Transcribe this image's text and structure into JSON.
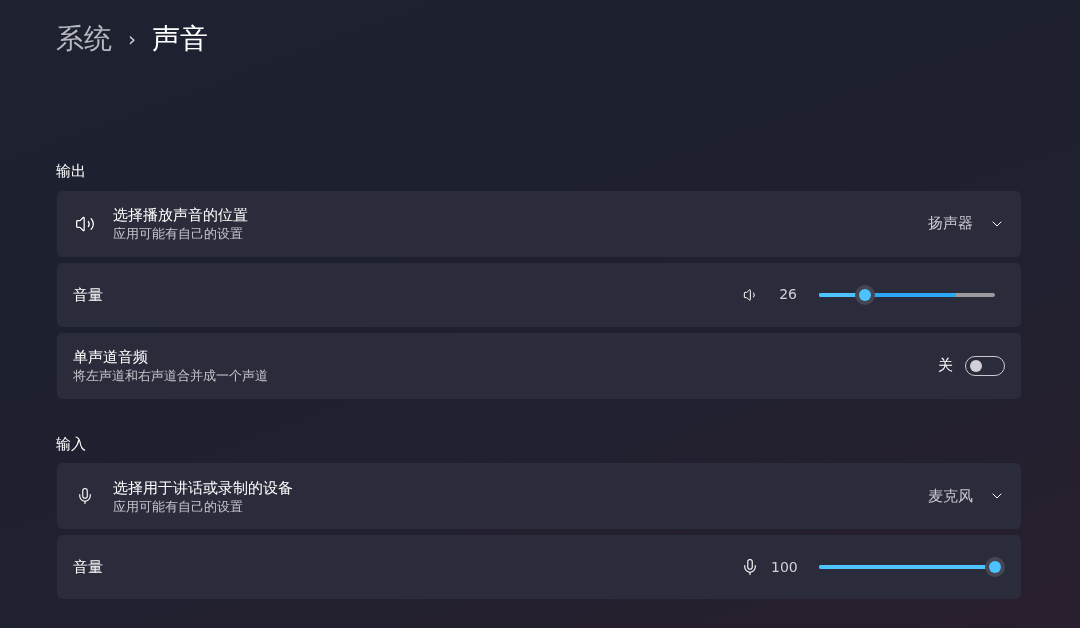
{
  "breadcrumb": [
    {
      "label": "系统",
      "selected": false
    },
    {
      "label": "声音",
      "selected": true
    }
  ],
  "breadcrumb_separator": "›",
  "sections": [
    {
      "title": "输出",
      "items": [
        {
          "kind": "dropdown",
          "title": "选择播放声音的位置",
          "subtitle": "应用可能有自己的设置",
          "value": "扬声器"
        },
        {
          "kind": "slider",
          "title": "音量",
          "reading": "26",
          "level": 0.26,
          "meter": {
            "level": 0.78
          }
        },
        {
          "kind": "toggle",
          "title": "单声道音频",
          "subtitle": "将左声道和右声道合并成一个声道",
          "state_label": "关",
          "on": false
        }
      ]
    },
    {
      "title": "输入",
      "items": [
        {
          "kind": "dropdown",
          "title": "选择用于讲话或录制的设备",
          "subtitle": "应用可能有自己的设置",
          "value": "麦克风"
        },
        {
          "kind": "slider",
          "title": "音量",
          "reading": "100",
          "level": 1.0
        }
      ]
    }
  ]
}
